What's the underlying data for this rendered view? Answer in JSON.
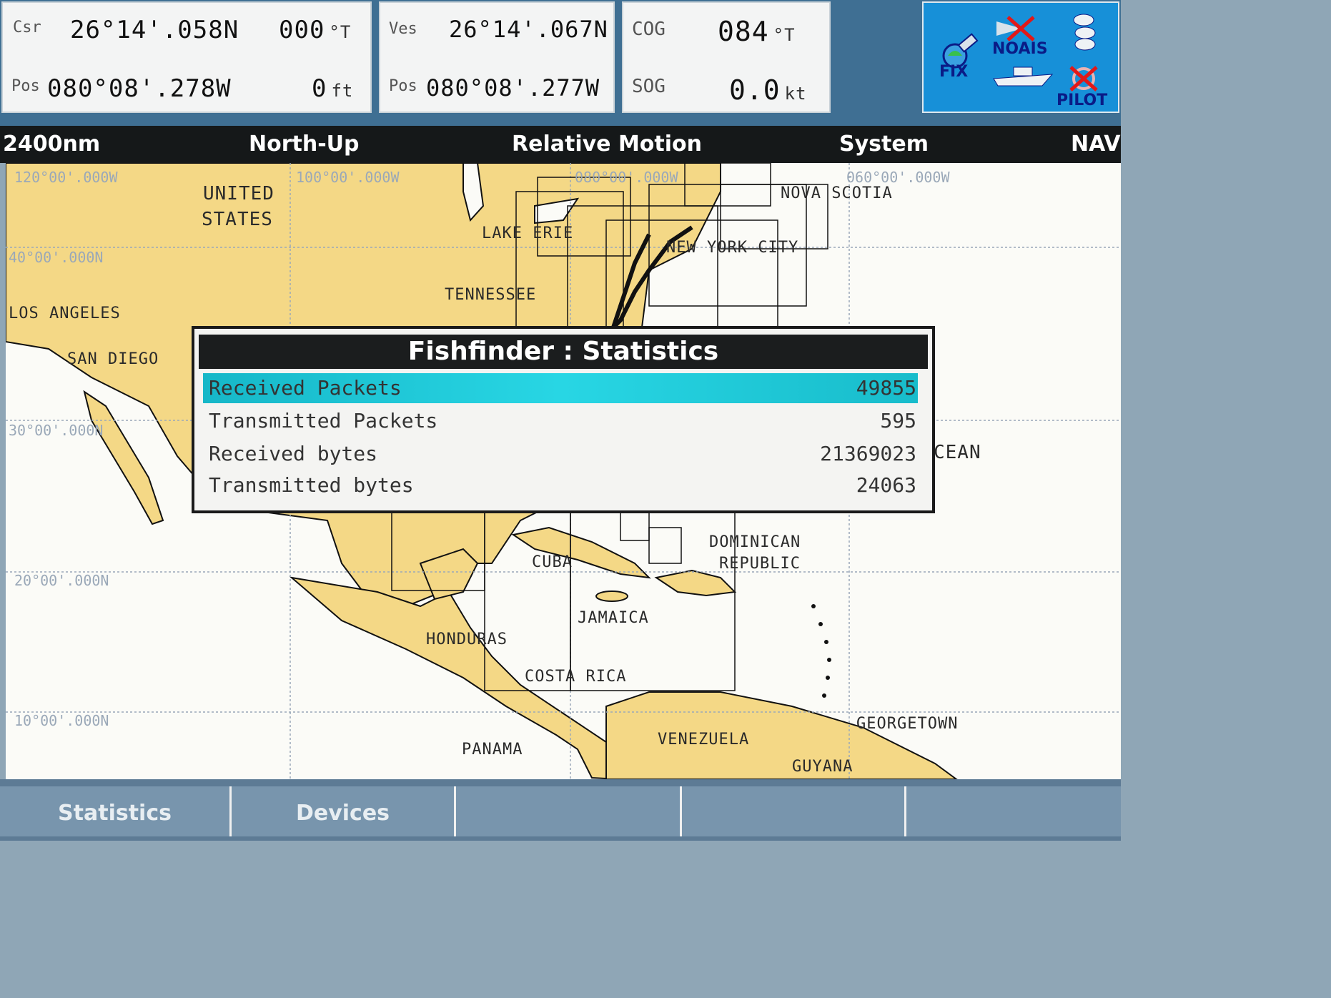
{
  "header": {
    "cursor": {
      "label_top": "Csr",
      "label_bottom": "Pos",
      "lat": "26°14'.058N",
      "lon": "080°08'.278W",
      "bearing": "000",
      "bearing_unit": "°T",
      "range": "0",
      "range_unit": "ft"
    },
    "vessel": {
      "label_top": "Ves",
      "label_bottom": "Pos",
      "lat": "26°14'.067N",
      "lon": "080°08'.277W"
    },
    "course": {
      "cog_label": "COG",
      "cog": "084",
      "cog_unit": "°T",
      "sog_label": "SOG",
      "sog": "0.0",
      "sog_unit": "kt"
    },
    "status_icons": {
      "fix": "FIX",
      "noais": "NOAIS",
      "pilot": "PILOT",
      "icons": [
        "gps-satellite-icon",
        "ais-off-icon",
        "boat-icon",
        "pilot-off-icon",
        "stack-icon"
      ]
    }
  },
  "navbar": {
    "range": "2400nm",
    "orientation": "North-Up",
    "motion": "Relative Motion",
    "system": "System",
    "mode": "NAV"
  },
  "map": {
    "grid_labels": [
      "120°00'.000W",
      "100°00'.000W",
      "080°00'.000W",
      "060°00'.000W",
      "40°00'.000N",
      "30°00'.000N",
      "20°00'.000N",
      "10°00'.000N"
    ],
    "places": [
      "UNITED",
      "STATES",
      "LAKE ERIE",
      "NOVA SCOTIA",
      "NEW YORK CITY",
      "TENNESSEE",
      "LOS ANGELES",
      "SAN DIEGO",
      "CEAN",
      "CUBA",
      "DOMINICAN",
      "REPUBLIC",
      "JAMAICA",
      "HONDURAS",
      "COSTA RICA",
      "GEORGETOWN",
      "VENEZUELA",
      "PANAMA",
      "GUYANA"
    ]
  },
  "dialog": {
    "title": "Fishfinder : Statistics",
    "rows": [
      {
        "label": "Received Packets",
        "value": "49855"
      },
      {
        "label": "Transmitted Packets",
        "value": "595"
      },
      {
        "label": "Received bytes",
        "value": "21369023"
      },
      {
        "label": "Transmitted bytes",
        "value": "24063"
      }
    ]
  },
  "softkeys": [
    "Statistics",
    "Devices",
    "",
    "",
    ""
  ],
  "colors": {
    "land": "#f4d886",
    "sea": "#fbfbf7",
    "highlight": "#1fc6d6",
    "topbar": "#3f6f93",
    "icon_panel": "#1790d8"
  }
}
